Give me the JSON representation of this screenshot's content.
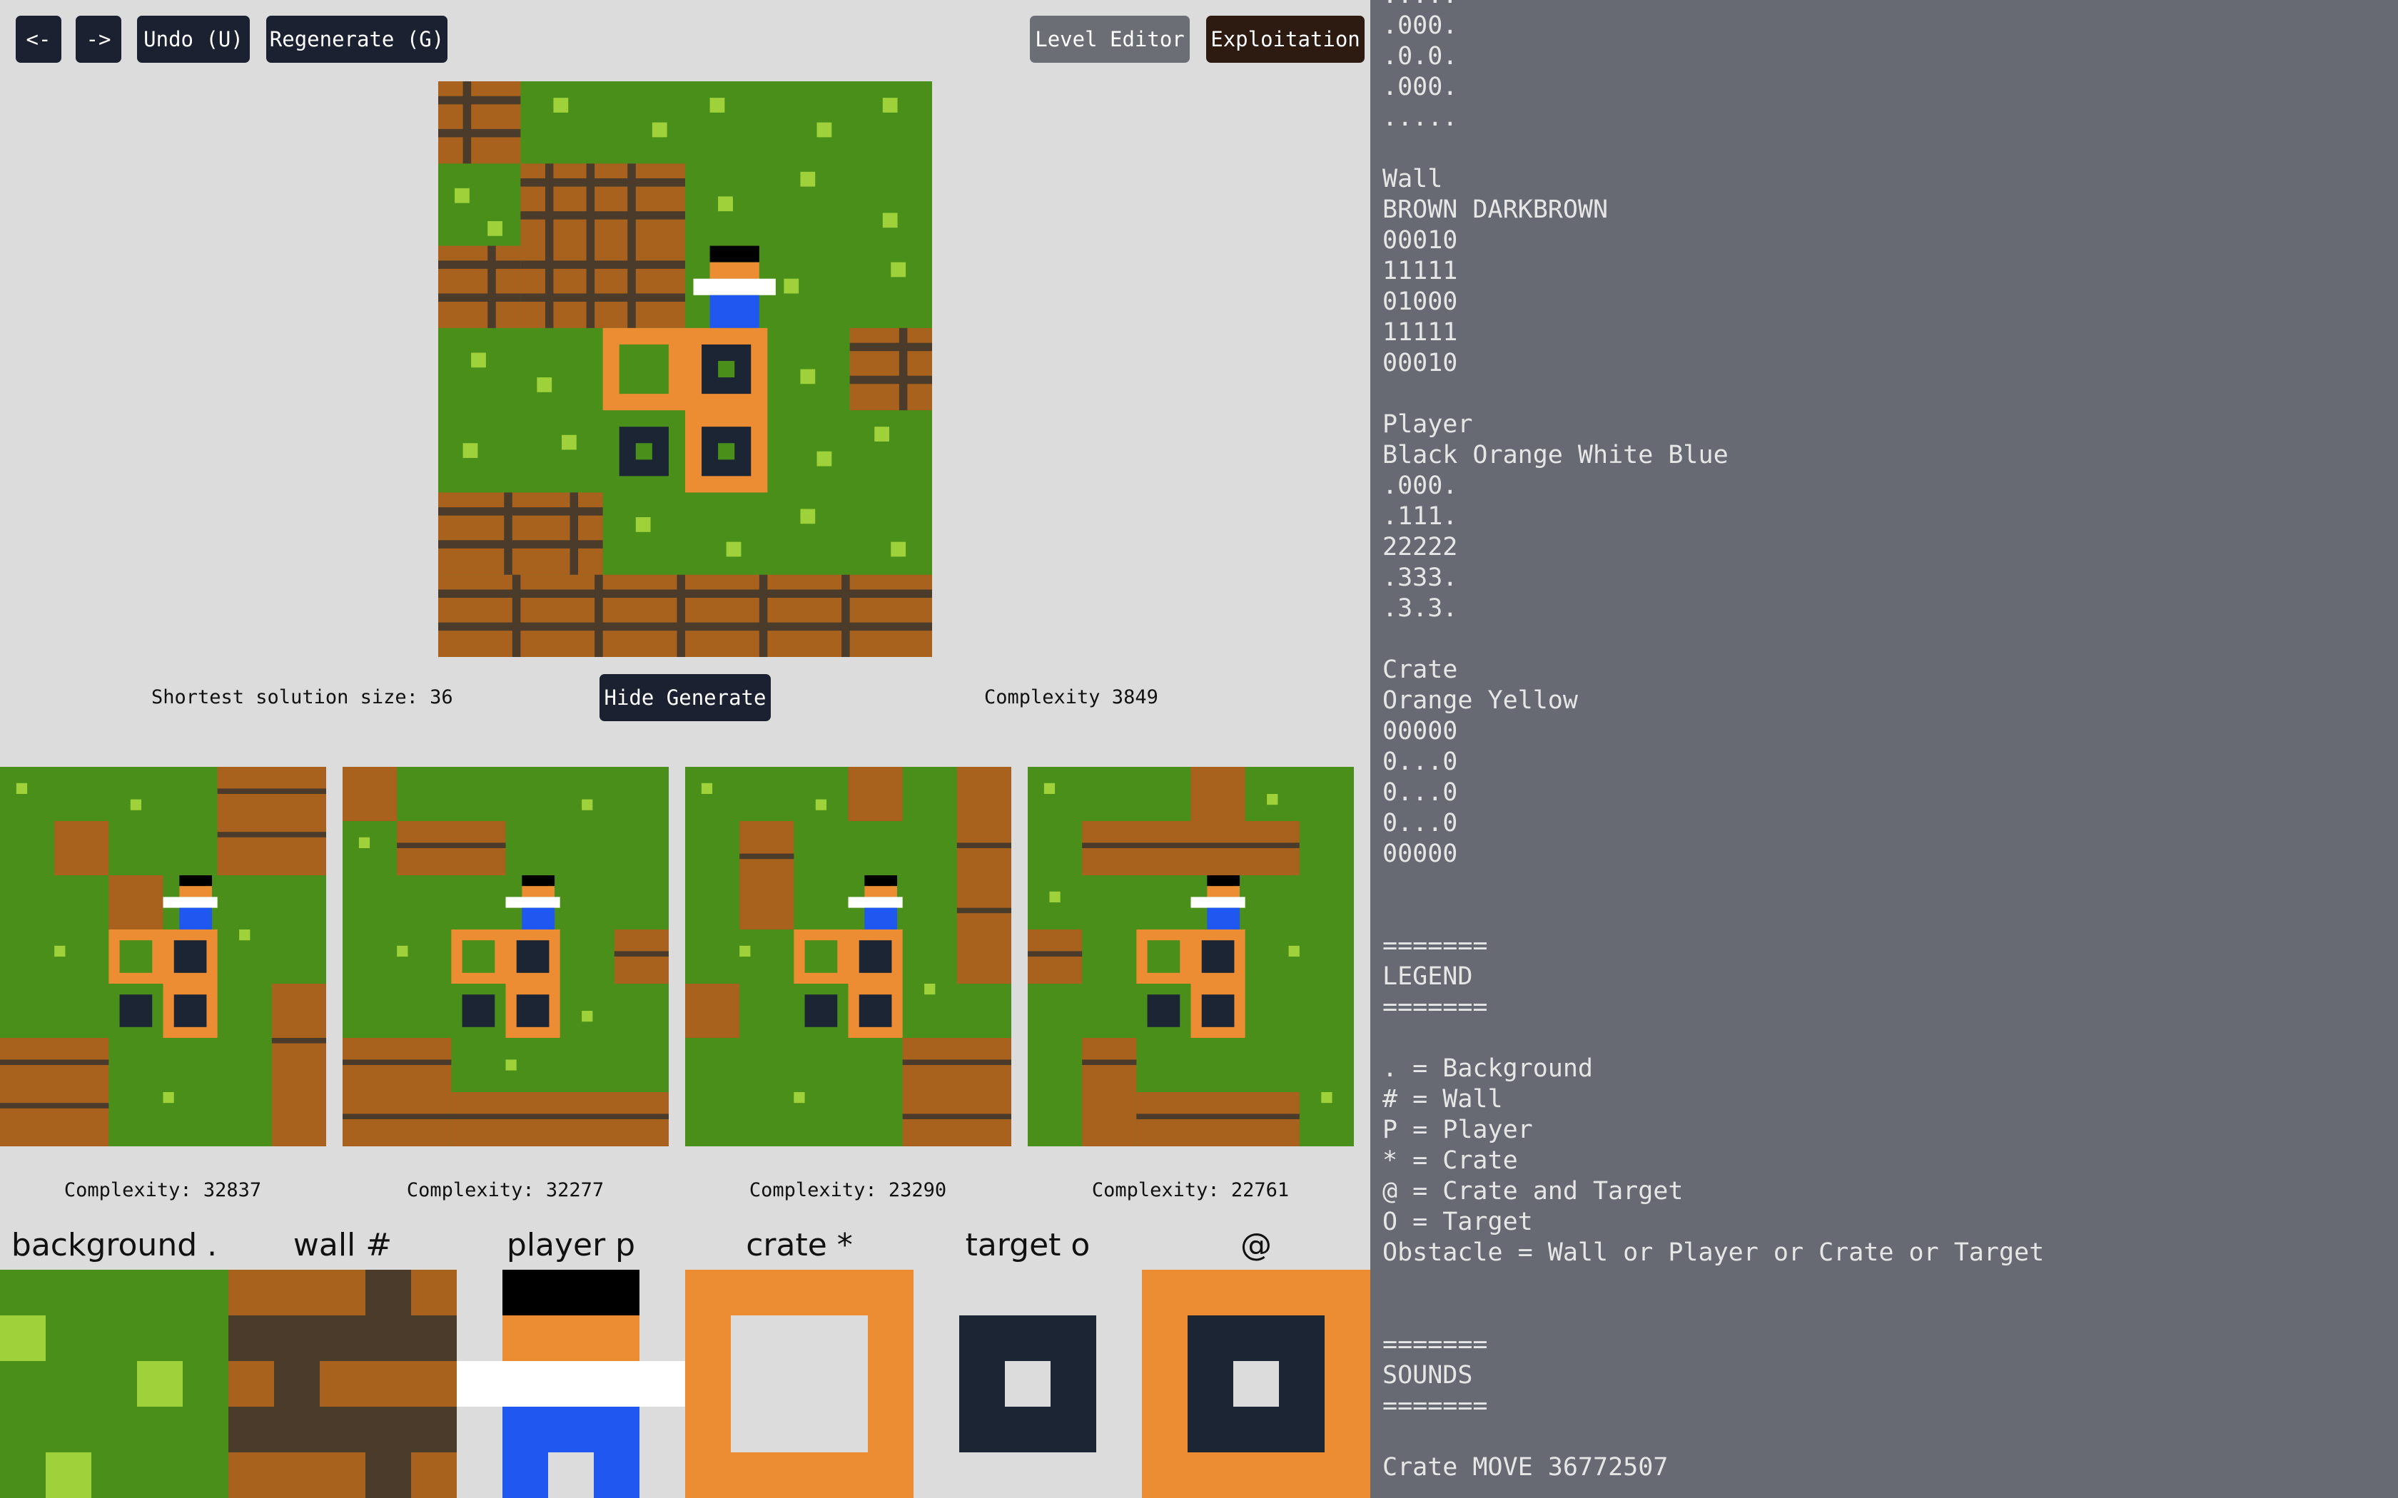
{
  "toolbar": {
    "back_label": "<-",
    "forward_label": "->",
    "undo_label": "Undo (U)",
    "regenerate_label": "Regenerate (G)",
    "level_editor_label": "Level Editor",
    "exploitation_label": "Exploitation"
  },
  "main": {
    "shortest_solution": "Shortest solution size: 36",
    "hide_generate_label": "Hide Generate",
    "complexity": "Complexity 3849"
  },
  "candidates": [
    {
      "complexity": "Complexity: 32837"
    },
    {
      "complexity": "Complexity: 32277"
    },
    {
      "complexity": "Complexity: 23290"
    },
    {
      "complexity": "Complexity: 22761"
    }
  ],
  "legend_tiles": [
    {
      "label": "background .",
      "icon": "background-tile-icon"
    },
    {
      "label": "wall #",
      "icon": "wall-tile-icon"
    },
    {
      "label": "player p",
      "icon": "player-tile-icon"
    },
    {
      "label": "crate *",
      "icon": "crate-tile-icon"
    },
    {
      "label": "target o",
      "icon": "target-tile-icon"
    },
    {
      "label": "@",
      "icon": "crate-on-target-tile-icon"
    }
  ],
  "colors": {
    "grass": "#4a8f1a",
    "grass_dots": "#9fd23a",
    "brick": "#a8621e",
    "mortar": "#4a3b2b",
    "player_black": "#000000",
    "player_orange": "#ec8c33",
    "player_white": "#ffffff",
    "player_blue": "#1f57f0",
    "crate": "#ec8c33",
    "target": "#1b2533",
    "button": "#1b2131",
    "panel": "#676a73"
  },
  "script_text": ".....\n.000.\n.0.0.\n.000.\n.....\n\nWall\nBROWN DARKBROWN\n00010\n11111\n01000\n11111\n00010\n\nPlayer\nBlack Orange White Blue\n.000.\n.111.\n22222\n.333.\n.3.3.\n\nCrate\nOrange Yellow\n00000\n0...0\n0...0\n0...0\n00000\n\n\n=======\nLEGEND\n=======\n\n. = Background\n# = Wall\nP = Player\n* = Crate\n@ = Crate and Target\nO = Target\nObstacle = Wall or Player or Crate or Target\n\n\n=======\nSOUNDS\n=======\n\nCrate MOVE 36772507"
}
